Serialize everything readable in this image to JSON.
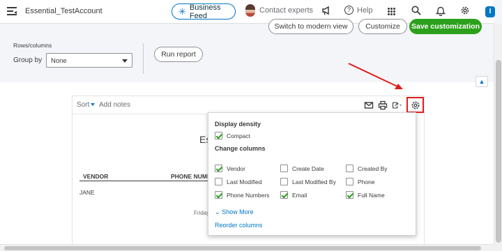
{
  "topbar": {
    "menu_icon": "menu-collapse-icon",
    "company": "Essential_TestAccount",
    "business_feed": "Business Feed",
    "contact_experts": "Contact experts",
    "help": "Help",
    "help_glyph": "?",
    "user_initial": "I"
  },
  "actions": {
    "modern_view": "Switch to modern view",
    "customize": "Customize",
    "save": "Save customization"
  },
  "filters": {
    "rows_columns": "Rows/columns",
    "group_by": "Group by",
    "group_by_value": "None",
    "run_report": "Run report"
  },
  "toolbar": {
    "sort": "Sort",
    "add_notes": "Add notes"
  },
  "report": {
    "title_partial": "Es",
    "col_vendor": "VENDOR",
    "col_phone": "PHONE NUMB",
    "row1": "JANE",
    "footer_partial": "Friday"
  },
  "popover": {
    "display_density": "Display density",
    "compact": "Compact",
    "change_columns": "Change columns",
    "columns": [
      {
        "label": "Vendor",
        "checked": true
      },
      {
        "label": "Create Date",
        "checked": false
      },
      {
        "label": "Created By",
        "checked": false
      },
      {
        "label": "Last Modified",
        "checked": false
      },
      {
        "label": "Last Modified By",
        "checked": false
      },
      {
        "label": "Phone",
        "checked": false
      },
      {
        "label": "Phone Numbers",
        "checked": true
      },
      {
        "label": "Email",
        "checked": true
      },
      {
        "label": "Full Name",
        "checked": true
      }
    ],
    "show_more": "Show More",
    "reorder_columns": "Reorder columns"
  },
  "colors": {
    "brand_blue": "#0077c5",
    "brand_green": "#2ca01c",
    "annotation_red": "#e11d1d"
  }
}
